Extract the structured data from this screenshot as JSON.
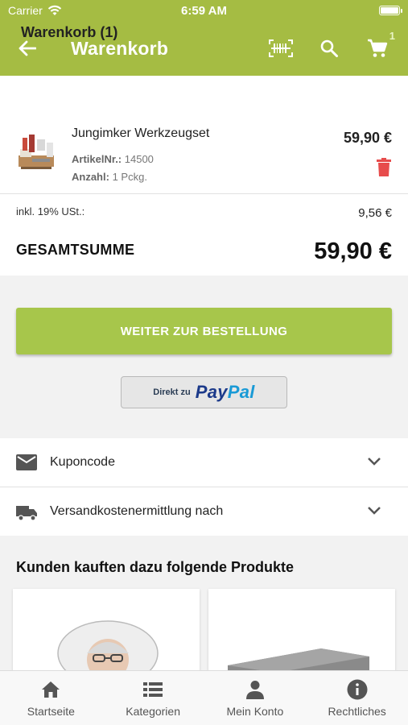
{
  "status": {
    "carrier": "Carrier",
    "time": "6:59 AM"
  },
  "header": {
    "title": "Warenkorb",
    "cart_count": "1"
  },
  "cart": {
    "title": "Warenkorb (1)",
    "item": {
      "name": "Jungimker Werkzeugset",
      "article_label": "ArtikelNr.:",
      "article_no": "14500",
      "quantity_label": "Anzahl:",
      "quantity": "1 Pckg.",
      "price": "59,90 €"
    },
    "tax_label": "inkl. 19% USt.:",
    "tax_value": "9,56 €",
    "total_label": "GESAMTSUMME",
    "total_value": "59,90 €"
  },
  "actions": {
    "order_label": "WEITER ZUR BESTELLUNG",
    "paypal_prefix": "Direkt zu",
    "paypal_pay": "Pay",
    "paypal_pal": "Pal"
  },
  "sections": {
    "coupon": "Kuponcode",
    "shipping": "Versandkostenermittlung nach"
  },
  "recommendations": {
    "title": "Kunden kauften dazu folgende Produkte"
  },
  "nav": {
    "home": "Startseite",
    "categories": "Kategorien",
    "account": "Mein Konto",
    "legal": "Rechtliches"
  },
  "colors": {
    "brand": "#a5bc43",
    "button": "#a7c64b",
    "delete": "#e74c4c",
    "paypal_dark": "#1c3a8a",
    "paypal_light": "#199ad6"
  }
}
